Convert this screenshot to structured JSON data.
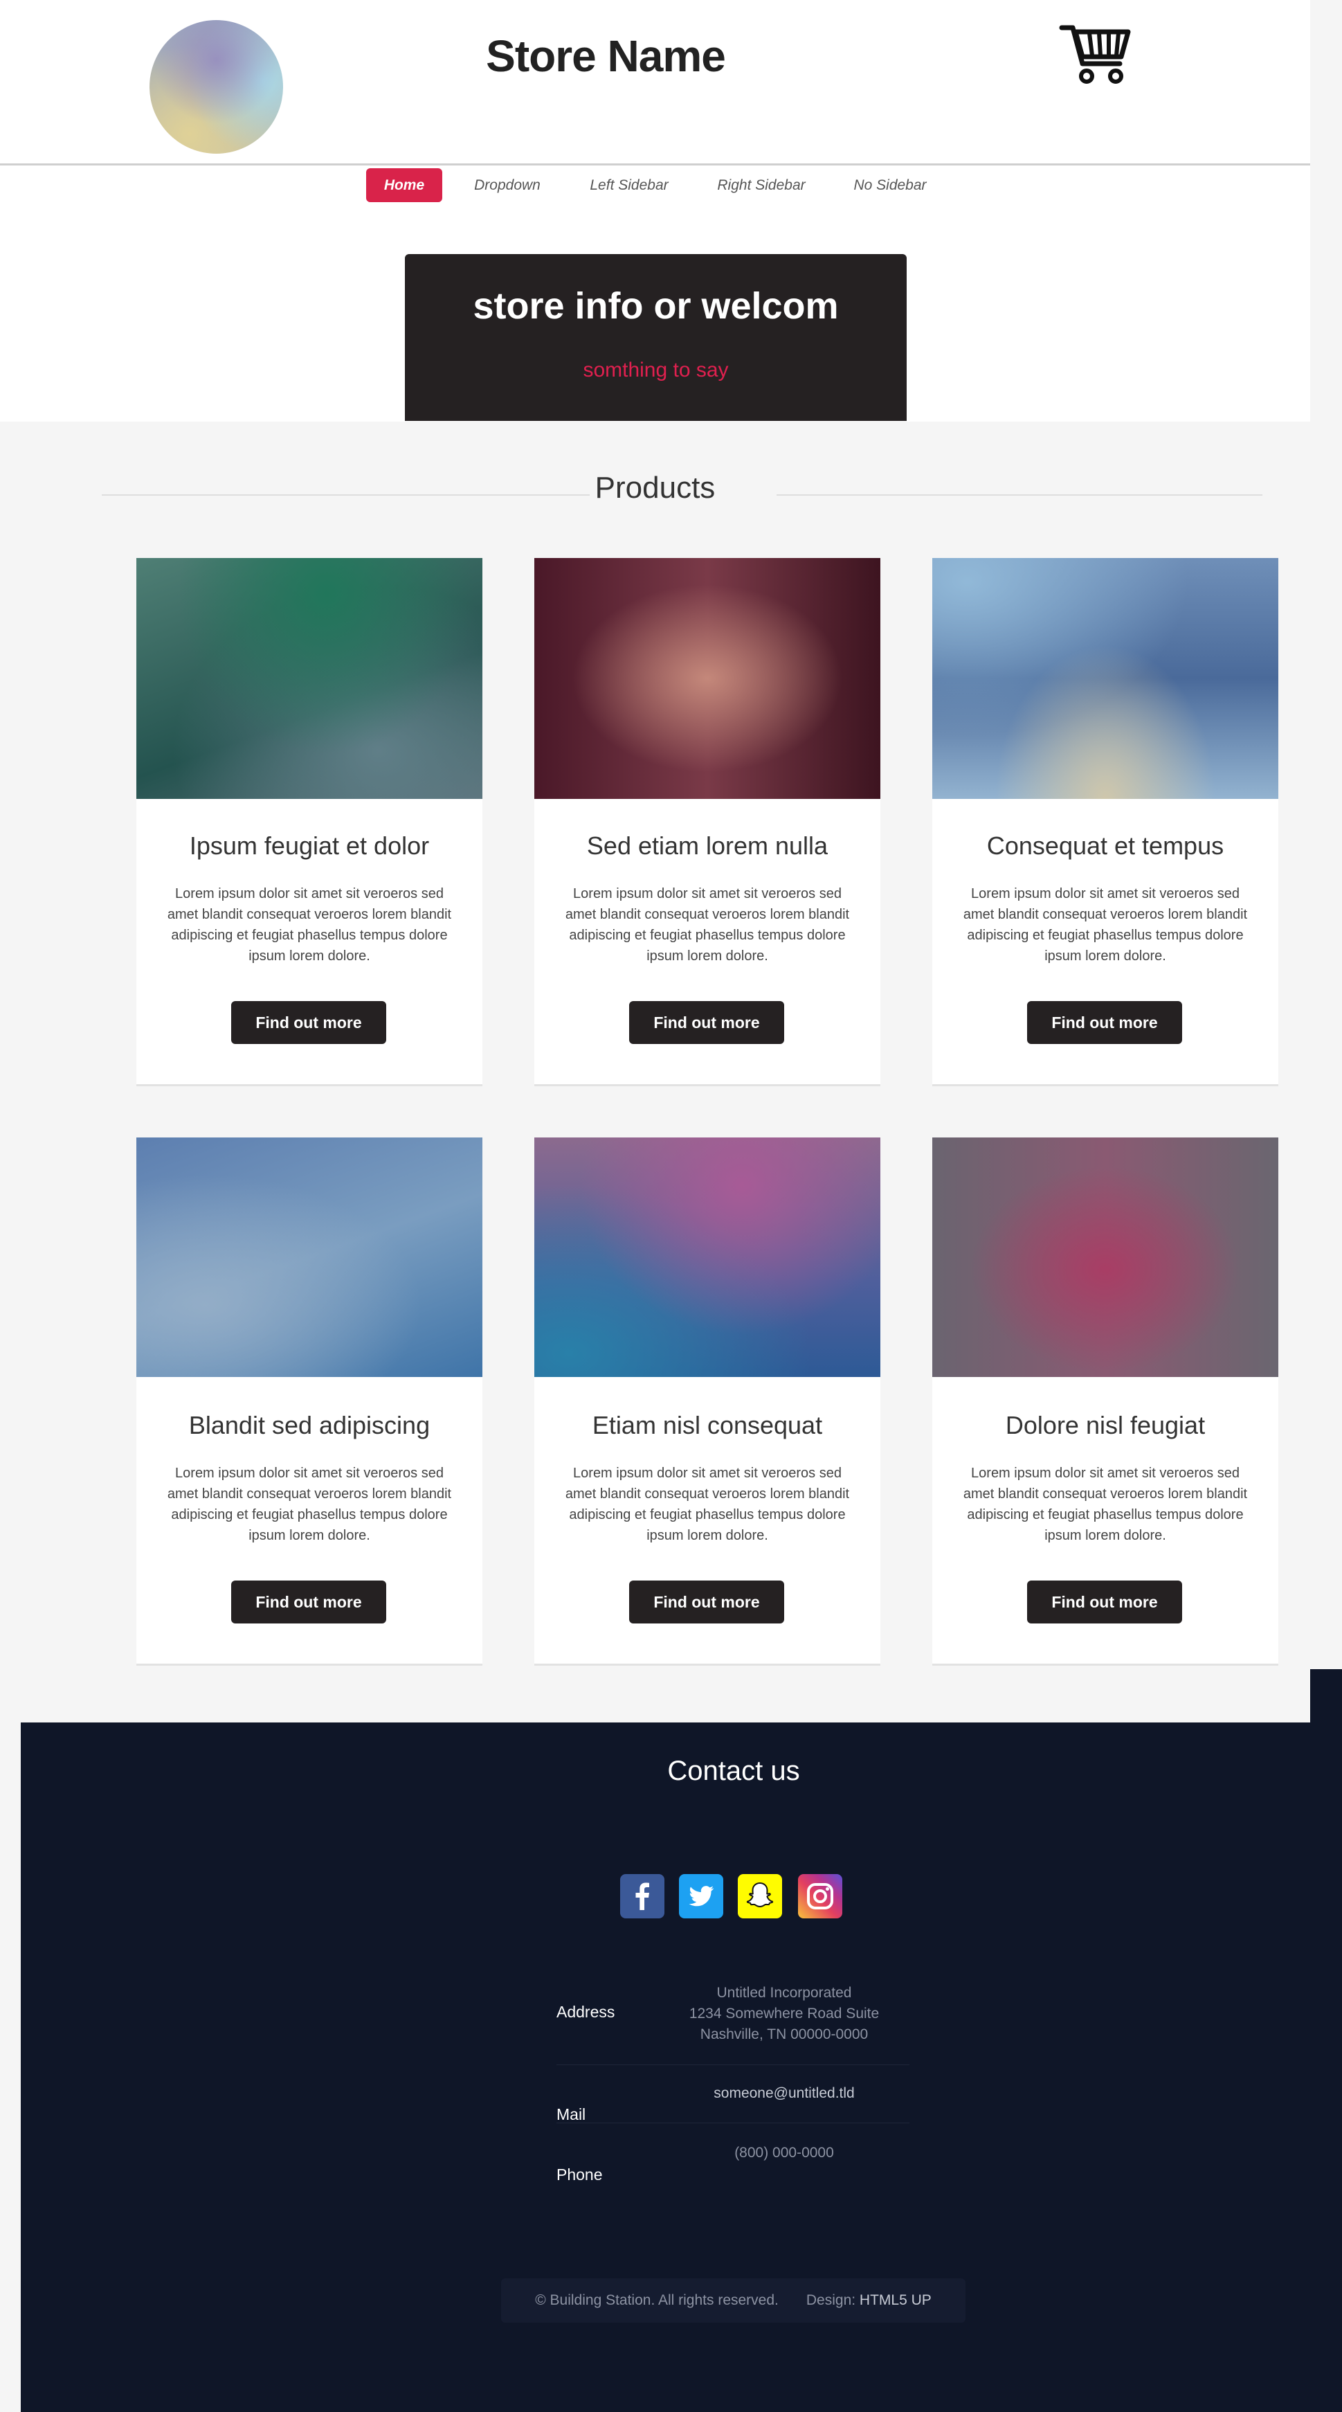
{
  "header": {
    "store_name": "Store Name",
    "logo_icon": "store-logo",
    "cart_icon": "shopping-cart-icon"
  },
  "nav": {
    "items": [
      {
        "label": "Home",
        "active": true
      },
      {
        "label": "Dropdown",
        "active": false
      },
      {
        "label": "Left Sidebar",
        "active": false
      },
      {
        "label": "Right Sidebar",
        "active": false
      },
      {
        "label": "No Sidebar",
        "active": false
      }
    ],
    "accent_color": "#d9234a"
  },
  "banner": {
    "title": "store info or welcom",
    "subtitle": "somthing to say",
    "subtitle_color": "#e0204f"
  },
  "products": {
    "section_title": "Products",
    "button_label": "Find out more",
    "items": [
      {
        "title": "Ipsum feugiat et dolor",
        "text": "Lorem ipsum dolor sit amet sit veroeros sed amet blandit consequat veroeros lorem blandit adipiscing et feugiat phasellus tempus dolore ipsum lorem dolore."
      },
      {
        "title": "Sed etiam lorem nulla",
        "text": "Lorem ipsum dolor sit amet sit veroeros sed amet blandit consequat veroeros lorem blandit adipiscing et feugiat phasellus tempus dolore ipsum lorem dolore."
      },
      {
        "title": "Consequat et tempus",
        "text": "Lorem ipsum dolor sit amet sit veroeros sed amet blandit consequat veroeros lorem blandit adipiscing et feugiat phasellus tempus dolore ipsum lorem dolore."
      },
      {
        "title": "Blandit sed adipiscing",
        "text": "Lorem ipsum dolor sit amet sit veroeros sed amet blandit consequat veroeros lorem blandit adipiscing et feugiat phasellus tempus dolore ipsum lorem dolore."
      },
      {
        "title": "Etiam nisl consequat",
        "text": "Lorem ipsum dolor sit amet sit veroeros sed amet blandit consequat veroeros lorem blandit adipiscing et feugiat phasellus tempus dolore ipsum lorem dolore."
      },
      {
        "title": "Dolore nisl feugiat",
        "text": "Lorem ipsum dolor sit amet sit veroeros sed amet blandit consequat veroeros lorem blandit adipiscing et feugiat phasellus tempus dolore ipsum lorem dolore."
      }
    ]
  },
  "footer": {
    "contact_title": "Contact us",
    "social": [
      {
        "icon": "facebook-icon",
        "color": "#3b5998"
      },
      {
        "icon": "twitter-icon",
        "color": "#1da1f2"
      },
      {
        "icon": "snapchat-icon",
        "color": "#fffc00"
      },
      {
        "icon": "instagram-icon",
        "color": "#c13584"
      }
    ],
    "address_label": "Address",
    "address_lines": [
      "Untitled Incorporated",
      "1234 Somewhere Road Suite",
      "Nashville, TN 00000-0000"
    ],
    "mail_label": "Mail",
    "mail_value": "someone@untitled.tld",
    "phone_label": "Phone",
    "phone_value": "(800) 000-0000",
    "copyright": "© Building Station. All rights reserved.",
    "design_label": "Design:",
    "design_link": "HTML5 UP"
  }
}
